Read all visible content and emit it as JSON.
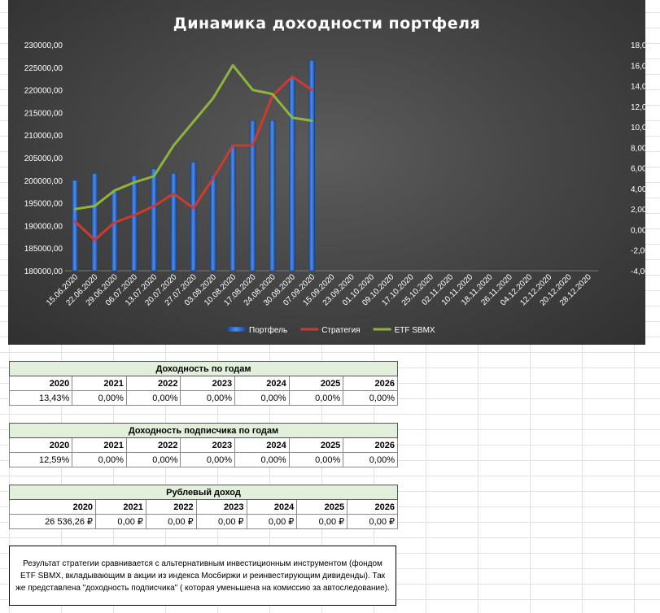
{
  "chart_data": {
    "type": "bar+line",
    "title": "Динамика доходности портфеля",
    "categories": [
      "15.06.2020",
      "22.06.2020",
      "29.06.2020",
      "06.07.2020",
      "13.07.2020",
      "20.07.2020",
      "27.07.2020",
      "03.08.2020",
      "10.08.2020",
      "17.08.2020",
      "24.08.2020",
      "30.08.2020",
      "07.09.2020",
      "15.09.2020",
      "23.09.2020",
      "01.10.2020",
      "09.10.2020",
      "17.10.2020",
      "25.10.2020",
      "02.11.2020",
      "10.11.2020",
      "18.11.2020",
      "26.11.2020",
      "04.12.2020",
      "12.12.2020",
      "20.12.2020",
      "28.12.2020"
    ],
    "left_axis": {
      "min": 180000,
      "max": 230000,
      "step": 5000,
      "ticks": [
        "180000,00",
        "185000,00",
        "190000,00",
        "195000,00",
        "200000,00",
        "205000,00",
        "210000,00",
        "215000,00",
        "220000,00",
        "225000,00",
        "230000,00"
      ]
    },
    "right_axis": {
      "min": -4,
      "max": 18,
      "step": 2,
      "ticks": [
        "-4,00%",
        "-2,00%",
        "0,00%",
        "2,00%",
        "4,00%",
        "6,00%",
        "8,00%",
        "10,00%",
        "12,00%",
        "14,00%",
        "16,00%",
        "18,00%"
      ]
    },
    "series": [
      {
        "name": "Портфель",
        "kind": "bar",
        "axis": "left",
        "color": "#2e6fd1",
        "values": [
          200000,
          201500,
          197500,
          201000,
          202500,
          201500,
          204000,
          201000,
          208000,
          213200,
          213200,
          222900,
          226500
        ]
      },
      {
        "name": "Стратегия",
        "kind": "line",
        "axis": "right",
        "color": "#cc3b2f",
        "values": [
          0.8,
          -1.0,
          0.7,
          1.4,
          2.3,
          3.5,
          2.1,
          5.0,
          8.2,
          8.2,
          13.0,
          14.9,
          13.6
        ]
      },
      {
        "name": "ETF SBMX",
        "kind": "line",
        "axis": "right",
        "color": "#8db53c",
        "values": [
          2.0,
          2.3,
          3.8,
          4.6,
          5.2,
          8.2,
          10.5,
          12.8,
          16.0,
          13.6,
          13.2,
          10.9,
          10.6
        ]
      }
    ],
    "legend": "bottom"
  },
  "tables": [
    {
      "title": "Доходность по годам",
      "years": [
        "2020",
        "2021",
        "2022",
        "2023",
        "2024",
        "2025",
        "2026"
      ],
      "values": [
        "13,43%",
        "0,00%",
        "0,00%",
        "0,00%",
        "0,00%",
        "0,00%",
        "0,00%"
      ]
    },
    {
      "title": "Доходность подписчика по годам",
      "years": [
        "2020",
        "2021",
        "2022",
        "2023",
        "2024",
        "2025",
        "2026"
      ],
      "values": [
        "12,59%",
        "0,00%",
        "0,00%",
        "0,00%",
        "0,00%",
        "0,00%",
        "0,00%"
      ]
    },
    {
      "title": "Рублевый доход",
      "years": [
        "2020",
        "2021",
        "2022",
        "2023",
        "2024",
        "2025",
        "2026"
      ],
      "values": [
        "26 536,26 ₽",
        "0,00 ₽",
        "0,00 ₽",
        "0,00 ₽",
        "0,00 ₽",
        "0,00 ₽",
        "0,00 ₽"
      ]
    }
  ],
  "note": "Результат стратегии сравнивается с альтернативным инвестиционным инструментом (фондом ETF SBMX, вкладывающим в акции из индекса Мосбиржи и реинвестирующим дивиденды). Так же представлена \"доходность подписчика\" ( которая уменьшена на комиссию за автоследование)."
}
